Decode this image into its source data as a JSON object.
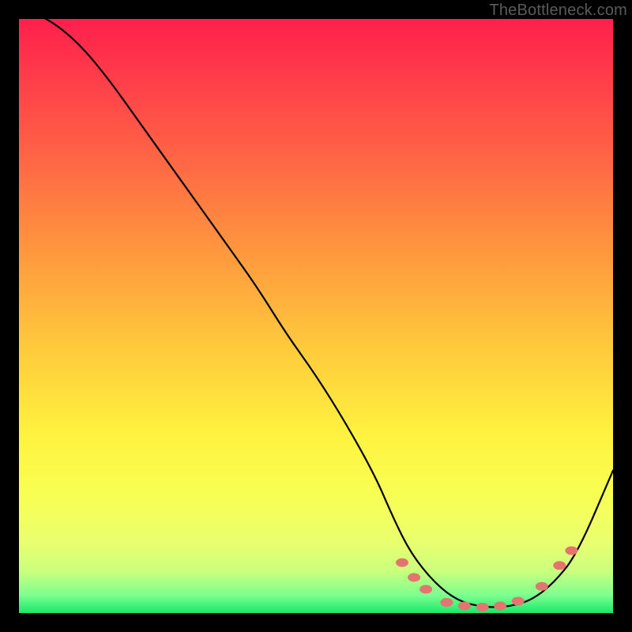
{
  "watermark": "TheBottleneck.com",
  "chart_data": {
    "type": "line",
    "title": "",
    "xlabel": "",
    "ylabel": "",
    "xlim": [
      0,
      100
    ],
    "ylim": [
      0,
      100
    ],
    "series": [
      {
        "name": "curve",
        "x": [
          0,
          5,
          10,
          15,
          20,
          25,
          30,
          35,
          40,
          45,
          50,
          55,
          60,
          63,
          66,
          70,
          74,
          78,
          82,
          86,
          90,
          94,
          100
        ],
        "values": [
          102,
          100,
          96,
          90,
          83,
          76,
          69,
          62,
          55,
          47,
          40,
          32,
          23,
          16,
          10,
          5,
          2,
          1,
          1,
          2,
          5,
          10,
          24
        ]
      }
    ],
    "markers": [
      {
        "name": "marker-cluster-left-1",
        "x": 64.5,
        "y": 8.5
      },
      {
        "name": "marker-cluster-left-2",
        "x": 66.5,
        "y": 6.0
      },
      {
        "name": "marker-cluster-left-3",
        "x": 68.5,
        "y": 4.0
      },
      {
        "name": "marker-trough-1",
        "x": 72.0,
        "y": 1.8
      },
      {
        "name": "marker-trough-2",
        "x": 75.0,
        "y": 1.2
      },
      {
        "name": "marker-trough-3",
        "x": 78.0,
        "y": 1.0
      },
      {
        "name": "marker-trough-4",
        "x": 81.0,
        "y": 1.2
      },
      {
        "name": "marker-trough-5",
        "x": 84.0,
        "y": 2.0
      },
      {
        "name": "marker-right-1",
        "x": 88.0,
        "y": 4.5
      },
      {
        "name": "marker-right-2",
        "x": 91.0,
        "y": 8.0
      },
      {
        "name": "marker-right-3",
        "x": 93.0,
        "y": 10.5
      }
    ],
    "marker_color": "#e4746f",
    "curve_color": "#000000"
  }
}
